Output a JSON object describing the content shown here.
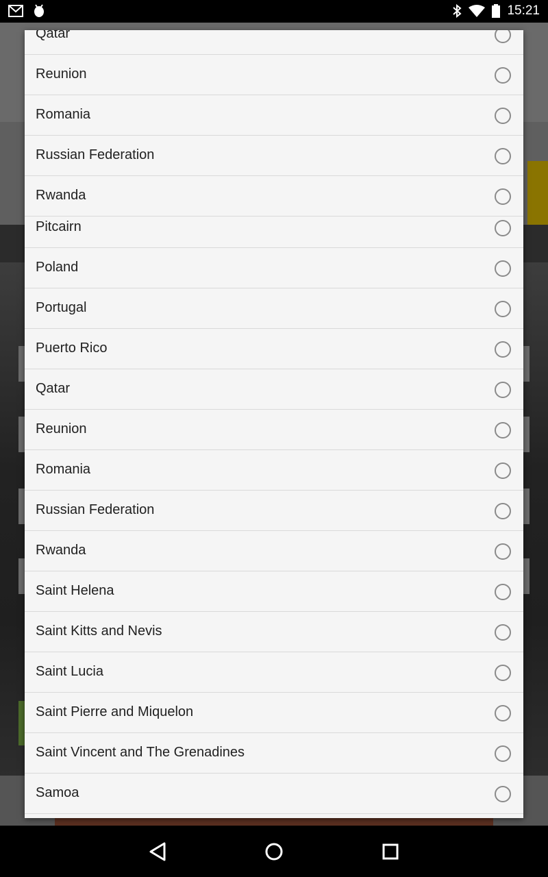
{
  "status_bar": {
    "time": "15:21",
    "left_icons": [
      "gmail-icon",
      "android-debug-icon"
    ],
    "right_icons": [
      "bluetooth-icon",
      "wifi-icon",
      "battery-icon"
    ]
  },
  "dialog": {
    "options": [
      {
        "label": "Qatar"
      },
      {
        "label": "Reunion"
      },
      {
        "label": "Romania"
      },
      {
        "label": "Russian Federation"
      },
      {
        "label": "Rwanda"
      },
      {
        "label": "Pitcairn"
      },
      {
        "label": "Poland"
      },
      {
        "label": "Portugal"
      },
      {
        "label": "Puerto Rico"
      },
      {
        "label": "Qatar"
      },
      {
        "label": "Reunion"
      },
      {
        "label": "Romania"
      },
      {
        "label": "Russian Federation"
      },
      {
        "label": "Rwanda"
      },
      {
        "label": "Saint Helena"
      },
      {
        "label": "Saint Kitts and Nevis"
      },
      {
        "label": "Saint Lucia"
      },
      {
        "label": "Saint Pierre and Miquelon"
      },
      {
        "label": "Saint Vincent and The Grenadines"
      },
      {
        "label": "Samoa"
      }
    ]
  },
  "nav_bar": {
    "buttons": [
      "back-icon",
      "home-icon",
      "recents-icon"
    ]
  }
}
